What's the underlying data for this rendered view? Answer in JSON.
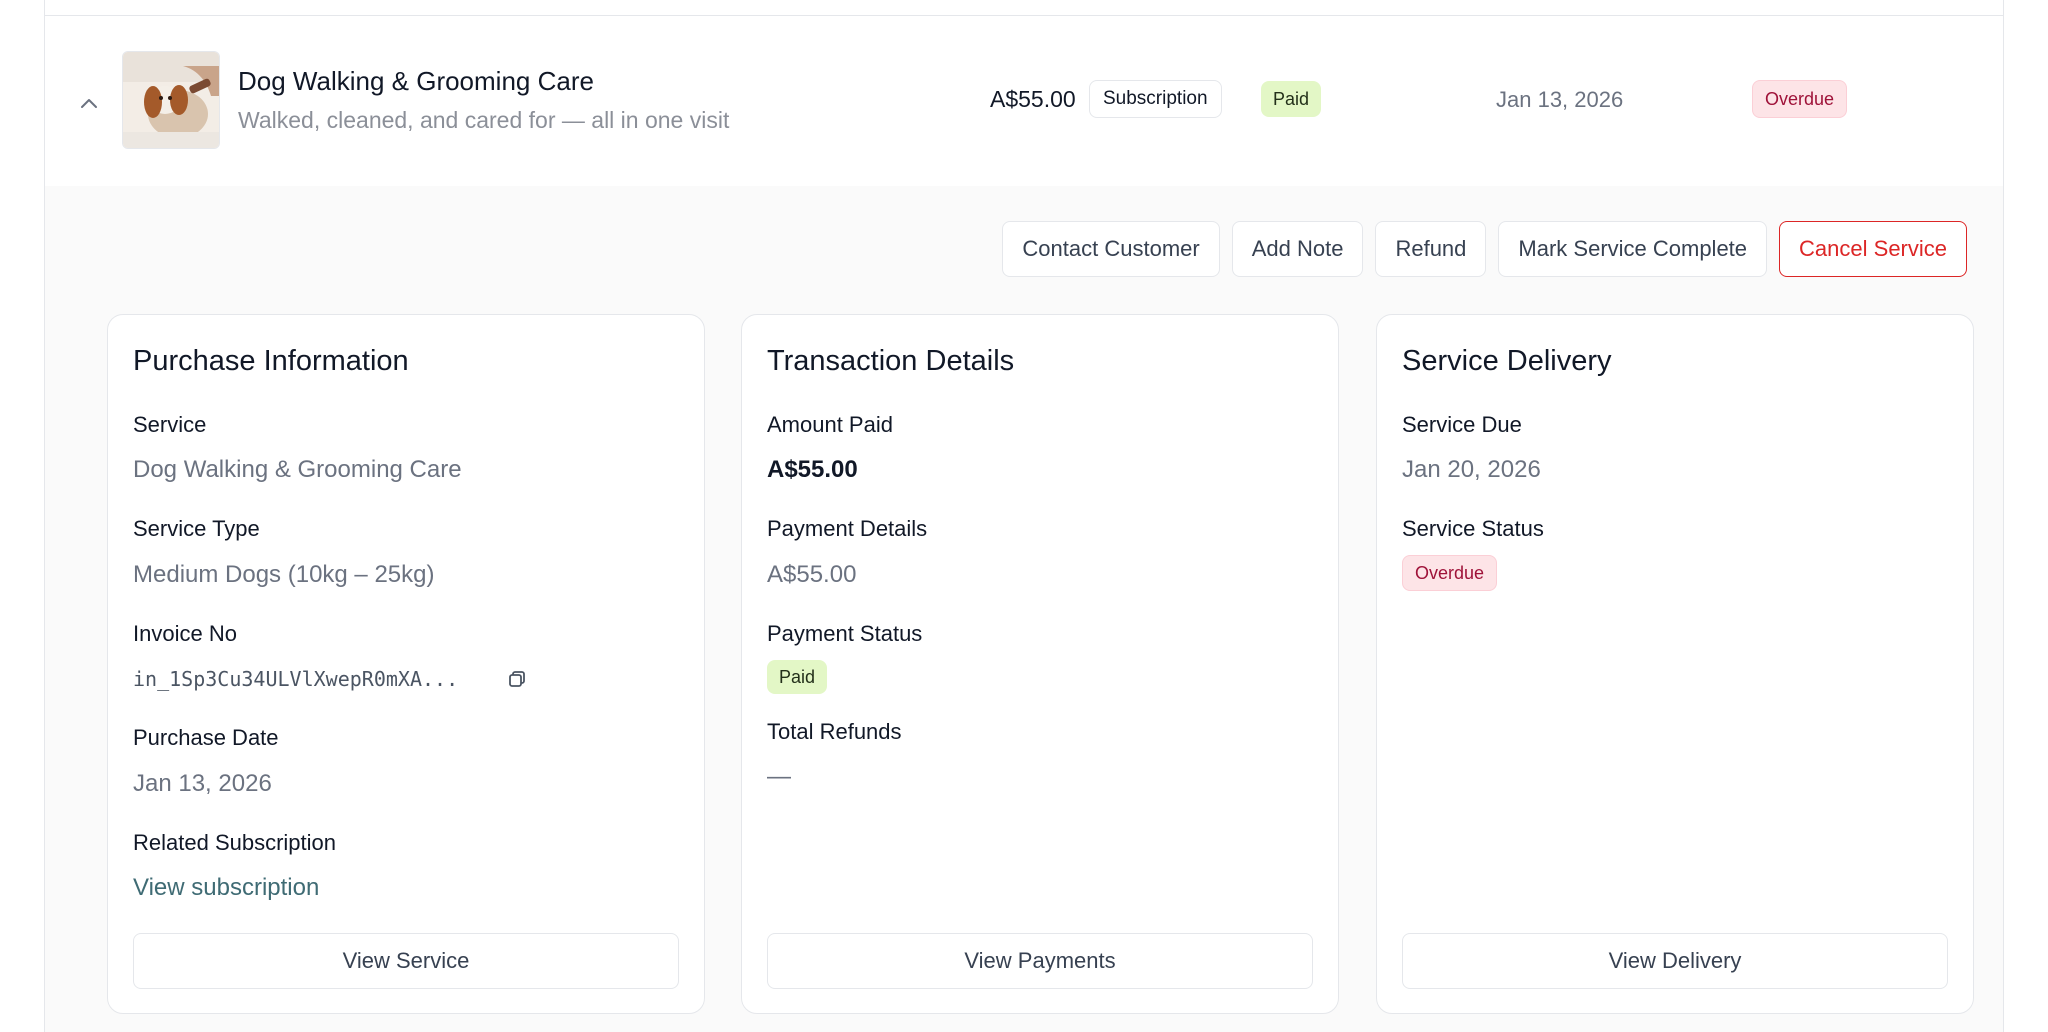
{
  "row": {
    "title": "Dog Walking & Grooming Care",
    "subtitle": "Walked, cleaned, and cared for — all in one visit",
    "price": "A$55.00",
    "billing_type": "Subscription",
    "payment_status": "Paid",
    "date": "Jan 13, 2026",
    "service_status": "Overdue",
    "expand_icon": "chevron-up-icon",
    "thumbnail": "dog-grooming-photo"
  },
  "actions": {
    "contact": "Contact Customer",
    "add_note": "Add Note",
    "refund": "Refund",
    "mark_complete": "Mark Service Complete",
    "cancel": "Cancel Service"
  },
  "purchase": {
    "heading": "Purchase Information",
    "service_label": "Service",
    "service_value": "Dog Walking & Grooming Care",
    "type_label": "Service Type",
    "type_value": "Medium Dogs (10kg – 25kg)",
    "invoice_label": "Invoice No",
    "invoice_value": "in_1Sp3Cu34ULVlXwepR0mXA...",
    "copy_icon": "copy-icon",
    "date_label": "Purchase Date",
    "date_value": "Jan 13, 2026",
    "subscription_label": "Related Subscription",
    "subscription_link": "View subscription",
    "button": "View Service"
  },
  "transaction": {
    "heading": "Transaction Details",
    "amount_label": "Amount Paid",
    "amount_value": "A$55.00",
    "details_label": "Payment Details",
    "details_value": "A$55.00",
    "status_label": "Payment Status",
    "status_value": "Paid",
    "refunds_label": "Total Refunds",
    "refunds_value": "—",
    "button": "View Payments"
  },
  "delivery": {
    "heading": "Service Delivery",
    "due_label": "Service Due",
    "due_value": "Jan 20, 2026",
    "status_label": "Service Status",
    "status_value": "Overdue",
    "button": "View Delivery"
  },
  "colors": {
    "paid_bg": "#e3f7c6",
    "overdue_bg": "#fde4e7",
    "overdue_text": "#9f1239",
    "danger": "#dc2626",
    "link": "#3f6b74"
  }
}
